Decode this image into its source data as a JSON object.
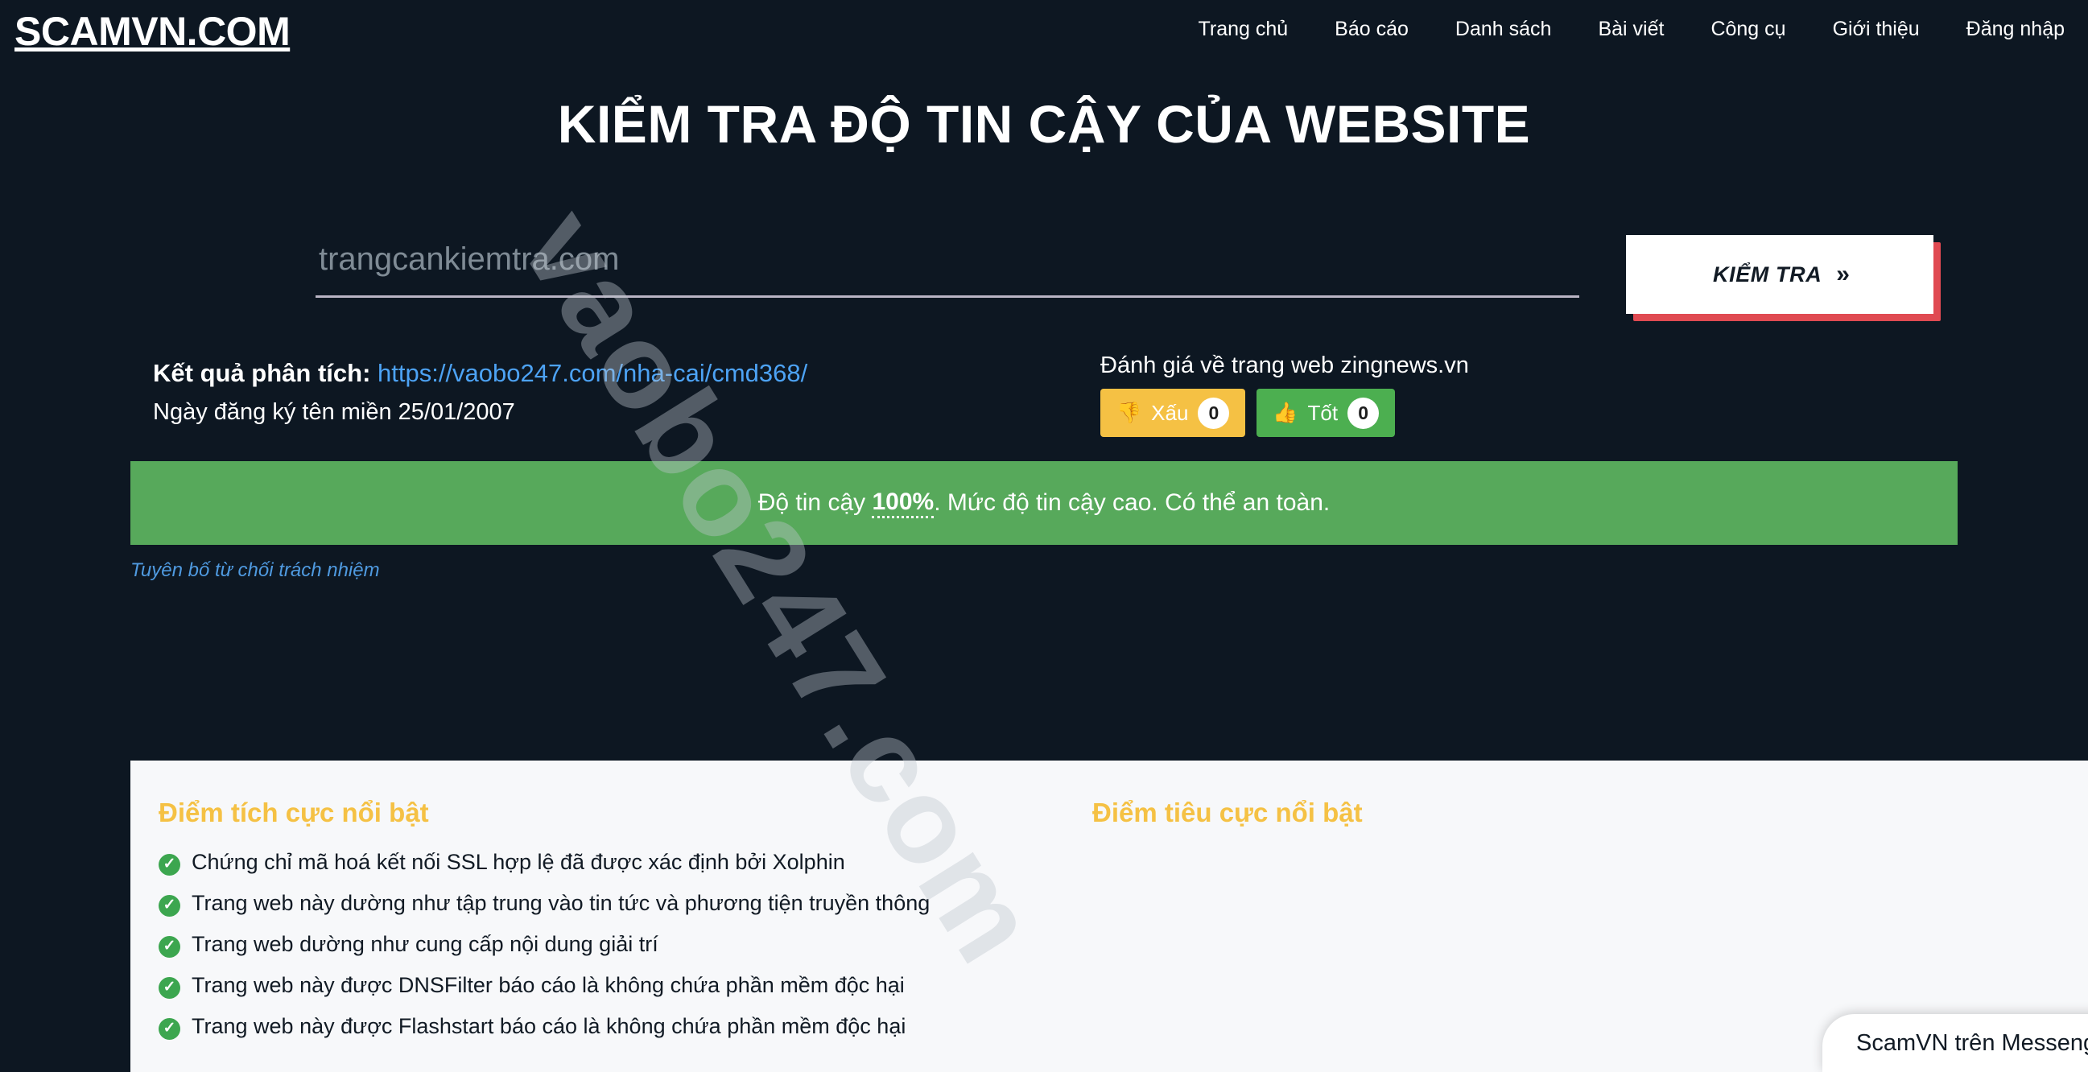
{
  "header": {
    "logo": "SCAMVN.COM",
    "nav": [
      {
        "label": "Trang chủ"
      },
      {
        "label": "Báo cáo"
      },
      {
        "label": "Danh sách"
      },
      {
        "label": "Bài viết"
      },
      {
        "label": "Công cụ"
      },
      {
        "label": "Giới thiệu"
      },
      {
        "label": "Đăng nhập"
      }
    ]
  },
  "hero": {
    "title": "KIỂM TRA ĐỘ TIN CẬY CỦA WEBSITE",
    "search_placeholder": "trangcankiemtra.com",
    "search_value": "",
    "check_button": "KIỂM TRA",
    "check_button_chevron": "»"
  },
  "watermark": {
    "text": "vaobo247.com"
  },
  "result": {
    "label": "Kết quả phân tích:",
    "url": "https://vaobo247.com/nha-cai/cmd368/",
    "registration": "Ngày đăng ký tên miền 25/01/2007"
  },
  "rating": {
    "title": "Đánh giá về trang web zingnews.vn",
    "bad": {
      "icon": "thumbs-down",
      "label": "Xấu",
      "count": "0",
      "color": "#f5c144"
    },
    "good": {
      "icon": "thumbs-up",
      "label": "Tốt",
      "count": "0",
      "color": "#4caf50"
    }
  },
  "trust": {
    "prefix": "Độ tin cậy",
    "percent": "100%",
    "suffix": ". Mức độ tin cậy cao. Có thể an toàn.",
    "color": "#57a95b"
  },
  "disclaimer": "Tuyên bố từ chối trách nhiệm",
  "panel": {
    "positive": {
      "title": "Điểm tích cực nổi bật",
      "items": [
        "Chứng chỉ mã hoá kết nối SSL hợp lệ đã được xác định bởi Xolphin",
        "Trang web này dường như tập trung vào tin tức và phương tiện truyền thông",
        "Trang web dường như cung cấp nội dung giải trí",
        "Trang web này được DNSFilter báo cáo là không chứa phần mềm độc hại",
        "Trang web này được Flashstart báo cáo là không chứa phần mềm độc hại"
      ],
      "check_icon": "✓"
    },
    "negative": {
      "title": "Điểm tiêu cực nổi bật",
      "items": []
    }
  },
  "messenger": {
    "label": "ScamVN trên Messenger"
  }
}
